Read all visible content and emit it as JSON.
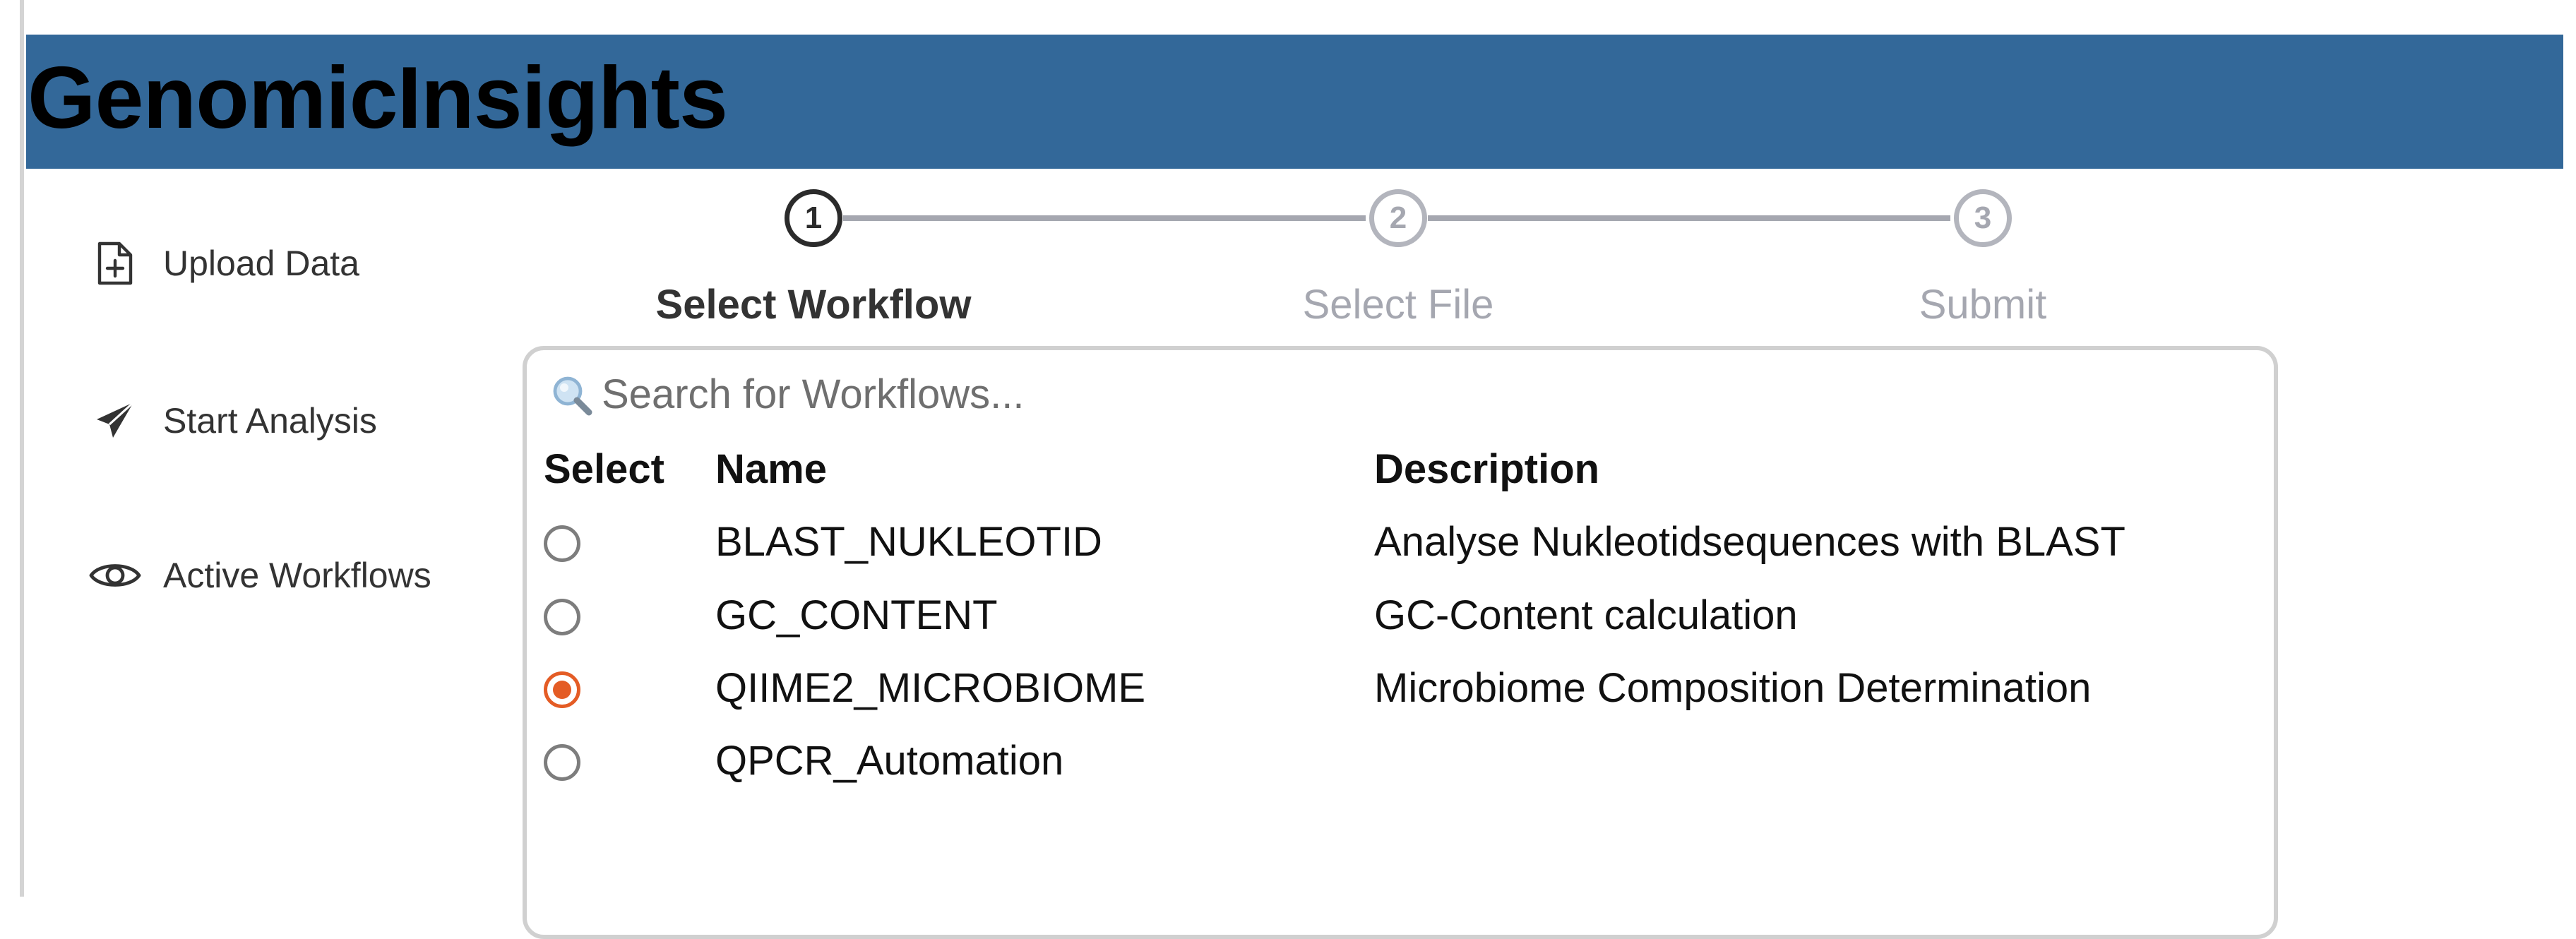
{
  "app": {
    "title": "GenomicInsights"
  },
  "sidebar": {
    "items": [
      {
        "label": "Upload Data",
        "icon": "file-plus-icon"
      },
      {
        "label": "Start Analysis",
        "icon": "paper-plane-icon"
      },
      {
        "label": "Active Workflows",
        "icon": "eye-icon"
      }
    ]
  },
  "stepper": {
    "steps": [
      {
        "number": "1",
        "label": "Select Workflow",
        "state": "active"
      },
      {
        "number": "2",
        "label": "Select File",
        "state": "inactive"
      },
      {
        "number": "3",
        "label": "Submit",
        "state": "inactive"
      }
    ]
  },
  "workflows": {
    "search": {
      "placeholder": "Search for Workflows...",
      "value": "",
      "icon": "search-icon"
    },
    "columns": {
      "select": "Select",
      "name": "Name",
      "description": "Description"
    },
    "rows": [
      {
        "name": "BLAST_NUKLEOTID",
        "description": "Analyse Nukleotidsequences with BLAST",
        "selected": false
      },
      {
        "name": "GC_CONTENT",
        "description": "GC-Content calculation",
        "selected": false
      },
      {
        "name": "QIIME2_MICROBIOME",
        "description": "Microbiome Composition Determination",
        "selected": true
      },
      {
        "name": "QPCR_Automation",
        "description": "",
        "selected": false
      }
    ]
  },
  "colors": {
    "header": "#336899",
    "accent": "#e45c25",
    "step_active": "#2b2b2b",
    "step_inactive": "#a5a7b0"
  }
}
